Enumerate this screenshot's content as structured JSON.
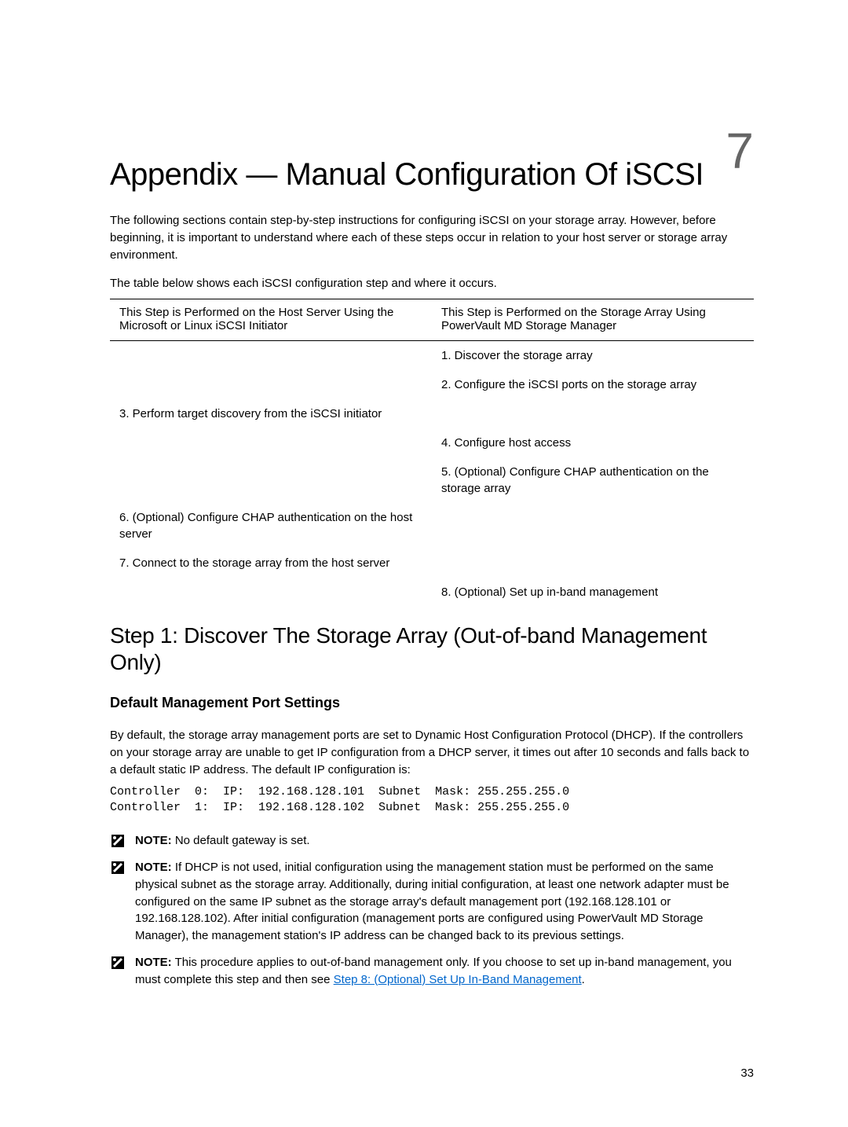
{
  "chapter": {
    "number": "7",
    "title": "Appendix — Manual Configuration Of iSCSI"
  },
  "intro": "The following sections contain step-by-step instructions for configuring iSCSI on your storage array. However, before beginning, it is important to understand where each of these steps occur in relation to your host server or storage array environment.",
  "table_caption": "The table below shows each iSCSI configuration step and where it occurs.",
  "table": {
    "header_left": "This Step is Performed on the Host Server Using the Microsoft or Linux iSCSI Initiator",
    "header_right": "This Step is Performed on the Storage Array Using PowerVault MD Storage Manager",
    "rows": [
      {
        "left": "",
        "right": "1. Discover the storage array"
      },
      {
        "left": "",
        "right": "2. Configure the iSCSI ports on the storage array"
      },
      {
        "left": "3. Perform target discovery from the iSCSI initiator",
        "right": ""
      },
      {
        "left": "",
        "right": "4. Configure host access"
      },
      {
        "left": "",
        "right": "5. (Optional) Configure CHAP authentication on the storage array"
      },
      {
        "left": "6. (Optional) Configure CHAP authentication on the host server",
        "right": ""
      },
      {
        "left": "7. Connect to the storage array from the host server",
        "right": ""
      },
      {
        "left": "",
        "right": "8. (Optional) Set up in-band management"
      }
    ]
  },
  "section": {
    "heading": "Step 1: Discover The Storage Array (Out-of-band Management Only)",
    "subheading": "Default Management Port Settings",
    "para1": "By default, the storage array management ports are set to Dynamic Host Configuration Protocol (DHCP). If the controllers on your storage array are unable to get IP configuration from a DHCP server, it times out after 10 seconds and falls back to a default static IP address. The default IP configuration is:",
    "code": "Controller  0:  IP:  192.168.128.101  Subnet  Mask: 255.255.255.0\nController  1:  IP:  192.168.128.102  Subnet  Mask: 255.255.255.0"
  },
  "notes": {
    "note1_label": "NOTE:",
    "note1_text": " No default gateway is set.",
    "note2_label": "NOTE:",
    "note2_text": " If DHCP is not used, initial configuration using the management station must be performed on the same physical subnet as the storage array. Additionally, during initial configuration, at least one network adapter must be configured on the same IP subnet as the storage array's default management port (192.168.128.101 or 192.168.128.102). After initial configuration (management ports are configured using PowerVault MD Storage Manager), the management station's IP address can be changed back to its previous settings.",
    "note3_label": "NOTE:",
    "note3_text_pre": " This procedure applies to out-of-band management only. If you choose to set up in-band management, you must complete this step and then see ",
    "note3_link": "Step 8: (Optional) Set Up In-Band Management",
    "note3_text_post": "."
  },
  "page_number": "33"
}
